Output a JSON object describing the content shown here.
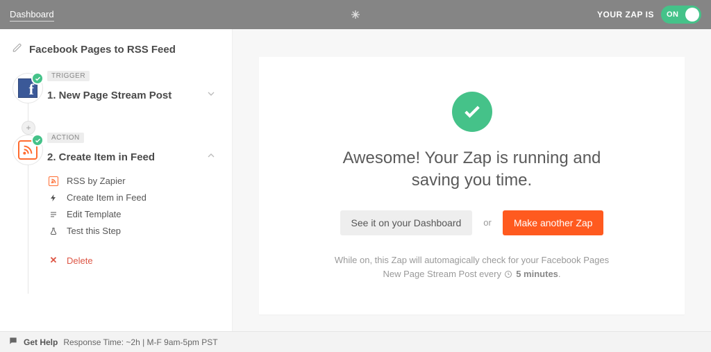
{
  "topbar": {
    "dashboard_link": "Dashboard",
    "status_label": "YOUR ZAP IS",
    "toggle": {
      "label": "ON"
    }
  },
  "sidebar": {
    "zap_title": "Facebook Pages to RSS Feed",
    "steps": [
      {
        "tag": "TRIGGER",
        "title": "1. New Page Stream Post",
        "expanded": false
      },
      {
        "tag": "ACTION",
        "title": "2. Create Item in Feed",
        "expanded": true,
        "items": [
          {
            "key": "app",
            "label": "RSS by Zapier"
          },
          {
            "key": "action",
            "label": "Create Item in Feed"
          },
          {
            "key": "tmpl",
            "label": "Edit Template"
          },
          {
            "key": "test",
            "label": "Test this Step"
          }
        ],
        "delete_label": "Delete"
      }
    ]
  },
  "main": {
    "headline": "Awesome! Your Zap is running and saving you time.",
    "btn_dashboard": "See it on your Dashboard",
    "or": "or",
    "btn_make": "Make another Zap",
    "explain_prefix": "While on, this Zap will automagically check for your Facebook Pages New Page Stream Post every ",
    "interval": "5 minutes",
    "explain_suffix": "."
  },
  "footer": {
    "get_help": "Get Help",
    "response": "Response Time: ~2h  |  M-F 9am-5pm PST"
  }
}
